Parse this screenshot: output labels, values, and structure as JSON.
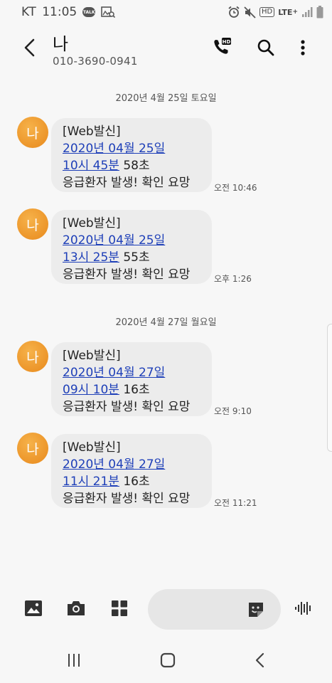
{
  "status_bar": {
    "carrier": "KT",
    "time": "11:05",
    "talk_badge": "TALK",
    "hd_badge": "HD",
    "lte": "LTE",
    "lte_plus": "+",
    "icons": [
      "kakaotalk-icon",
      "gallery-search-icon",
      "alarm-icon",
      "mute-icon",
      "hd-voice-icon",
      "lte-icon",
      "signal-icon",
      "battery-icon"
    ]
  },
  "header": {
    "contact_name": "나",
    "contact_number": "010-3690-0941",
    "hd_badge": "HD",
    "icons": [
      "back-icon",
      "hd-call-icon",
      "search-icon",
      "more-icon"
    ]
  },
  "conversation": {
    "avatar_initial": "나",
    "avatar_color": "#ee9a2c",
    "link_color": "#1e3fb8",
    "date_separators": [
      "2020년 4월 25일 토요일",
      "2020년 4월 27일 월요일"
    ],
    "messages": [
      {
        "sender": "[Web발신]",
        "date_link": "2020년 04월 25일",
        "time_link": "10시 45분",
        "seconds": " 58초",
        "body": "응급환자 발생! 확인 요망",
        "time": "오전 10:46"
      },
      {
        "sender": "[Web발신]",
        "date_link": "2020년 04월 25일",
        "time_link": "13시 25분",
        "seconds": " 55초",
        "body": "응급환자 발생! 확인 요망",
        "time": "오후 1:26"
      },
      {
        "sender": "[Web발신]",
        "date_link": "2020년 04월 27일",
        "time_link": "09시 10분",
        "seconds": " 16초",
        "body": "응급환자 발생! 확인 요망",
        "time": "오전 9:10"
      },
      {
        "sender": "[Web발신]",
        "date_link": "2020년 04월 27일",
        "time_link": "11시 21분",
        "seconds": " 16초",
        "body": "응급환자 발생! 확인 요망",
        "time": "오전 11:21"
      }
    ]
  },
  "composer": {
    "input_value": "",
    "icons": [
      "image-icon",
      "camera-icon",
      "apps-grid-icon",
      "sticker-icon",
      "voice-icon"
    ]
  },
  "nav_bar": {
    "icons": [
      "recent-apps-icon",
      "home-icon",
      "back-nav-icon"
    ]
  }
}
